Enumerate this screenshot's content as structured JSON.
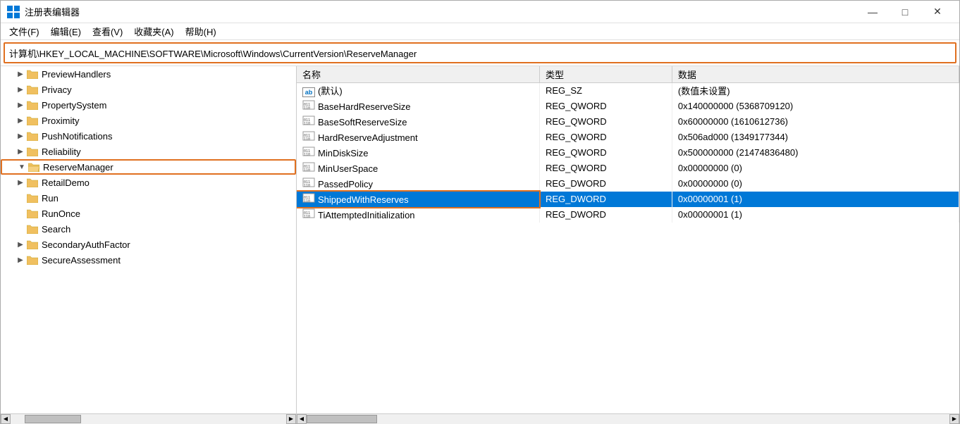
{
  "window": {
    "title": "注册表编辑器",
    "address": "计算机\\HKEY_LOCAL_MACHINE\\SOFTWARE\\Microsoft\\Windows\\CurrentVersion\\ReserveManager"
  },
  "menu": {
    "items": [
      "文件(F)",
      "编辑(E)",
      "查看(V)",
      "收藏夹(A)",
      "帮助(H)"
    ]
  },
  "tree": {
    "items": [
      {
        "label": "PreviewHandlers",
        "level": 1,
        "expanded": false,
        "selected": false
      },
      {
        "label": "Privacy",
        "level": 1,
        "expanded": false,
        "selected": false
      },
      {
        "label": "PropertySystem",
        "level": 1,
        "expanded": false,
        "selected": false
      },
      {
        "label": "Proximity",
        "level": 1,
        "expanded": false,
        "selected": false
      },
      {
        "label": "PushNotifications",
        "level": 1,
        "expanded": false,
        "selected": false
      },
      {
        "label": "Reliability",
        "level": 1,
        "expanded": false,
        "selected": false
      },
      {
        "label": "ReserveManager",
        "level": 1,
        "expanded": true,
        "selected": true
      },
      {
        "label": "RetailDemo",
        "level": 1,
        "expanded": false,
        "selected": false
      },
      {
        "label": "Run",
        "level": 1,
        "expanded": false,
        "selected": false
      },
      {
        "label": "RunOnce",
        "level": 1,
        "expanded": false,
        "selected": false
      },
      {
        "label": "Search",
        "level": 1,
        "expanded": false,
        "selected": false
      },
      {
        "label": "SecondaryAuthFactor",
        "level": 1,
        "expanded": false,
        "selected": false
      },
      {
        "label": "SecureAssessment",
        "level": 1,
        "expanded": false,
        "selected": false
      }
    ]
  },
  "columns": {
    "name": "名称",
    "type": "类型",
    "data": "数据"
  },
  "registry_values": [
    {
      "name": "(默认)",
      "type": "REG_SZ",
      "data": "(数值未设置)",
      "icon": "ab",
      "selected": false,
      "outlined": false
    },
    {
      "name": "BaseHardReserveSize",
      "type": "REG_QWORD",
      "data": "0x140000000 (5368709120)",
      "icon": "bin",
      "selected": false,
      "outlined": false
    },
    {
      "name": "BaseSoftReserveSize",
      "type": "REG_QWORD",
      "data": "0x60000000 (1610612736)",
      "icon": "bin",
      "selected": false,
      "outlined": false
    },
    {
      "name": "HardReserveAdjustment",
      "type": "REG_QWORD",
      "data": "0x506ad000 (1349177344)",
      "icon": "bin",
      "selected": false,
      "outlined": false
    },
    {
      "name": "MinDiskSize",
      "type": "REG_QWORD",
      "data": "0x500000000 (21474836480)",
      "icon": "bin",
      "selected": false,
      "outlined": false
    },
    {
      "name": "MinUserSpace",
      "type": "REG_QWORD",
      "data": "0x00000000 (0)",
      "icon": "bin",
      "selected": false,
      "outlined": false
    },
    {
      "name": "PassedPolicy",
      "type": "REG_DWORD",
      "data": "0x00000000 (0)",
      "icon": "bin",
      "selected": false,
      "outlined": false
    },
    {
      "name": "ShippedWithReserves",
      "type": "REG_DWORD",
      "data": "0x00000001 (1)",
      "icon": "bin",
      "selected": true,
      "outlined": true
    },
    {
      "name": "TiAttemptedInitialization",
      "type": "REG_DWORD",
      "data": "0x00000001 (1)",
      "icon": "bin",
      "selected": false,
      "outlined": false
    }
  ],
  "titlebar": {
    "minimize": "—",
    "maximize": "□",
    "close": "✕"
  }
}
